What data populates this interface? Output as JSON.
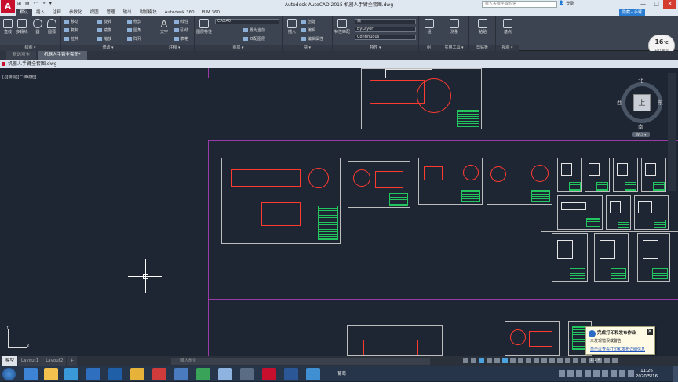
{
  "window": {
    "title": "Autodesk AutoCAD 2015    机器人手臂全套图.dwg",
    "search_placeholder": "键入关键字或短语",
    "signin": "登录",
    "controls": [
      "—",
      "□",
      "✕"
    ]
  },
  "app_button": "A",
  "quick_access": [
    "⊞",
    "▤",
    "↶",
    "↷",
    "▾"
  ],
  "ribbon_tabs": [
    "默认",
    "插入",
    "注释",
    "参数化",
    "视图",
    "管理",
    "输出",
    "附加模块",
    "Autodesk 360",
    "BIM 360"
  ],
  "active_tab": "默认",
  "cloud_button": "隐藏人手臂",
  "ribbon": {
    "draw": {
      "title": "绘图 ▾",
      "line": "直线",
      "polyline": "多段线",
      "circle": "圆",
      "arc": "圆弧"
    },
    "modify": {
      "title": "修改 ▾",
      "move": "移动",
      "rotate": "旋转",
      "trim": "修剪",
      "copy": "复制",
      "mirror": "镜像",
      "fillet": "圆角",
      "stretch": "拉伸",
      "scale": "缩放",
      "array": "阵列"
    },
    "annotation": {
      "title": "注释 ▾",
      "text": "文字",
      "dimension": "标注",
      "linear": "线性",
      "leader": "引线",
      "table": "表格"
    },
    "layers": {
      "title": "图层 ▾",
      "layer_props": "图层特性",
      "layer_name": "CAXA0",
      "state1": "置为当前",
      "state2": "匹配图层"
    },
    "block": {
      "title": "块 ▾",
      "insert": "插入",
      "create": "创建",
      "edit": "编辑",
      "attributes": "编辑属性"
    },
    "properties": {
      "title": "特性 ▾",
      "match": "特性匹配",
      "color": "白",
      "lineweight": "ByLayer",
      "linetype": "Continuous"
    },
    "groups": {
      "title": "组",
      "group": "组"
    },
    "utilities": {
      "title": "实用工具 ▾",
      "measure": "测量"
    },
    "clipboard": {
      "title": "剪贴板",
      "paste": "粘贴"
    },
    "view": {
      "title": "视图 ▾",
      "base": "基点"
    }
  },
  "temp_badge": {
    "value": "16",
    "unit": "°C",
    "sub": "+0.08k/s"
  },
  "doc_tabs": [
    "新选项卡",
    "机器人手臂全套图*"
  ],
  "active_doc_tab": "机器人手臂全套图*",
  "drawing": {
    "title": "机器人手臂全套图.dwg",
    "viewport_label": "[-][俯视][二维线框]"
  },
  "viewcube": {
    "top": "上",
    "north": "北",
    "south": "南",
    "west": "西",
    "east": "东",
    "wcs": "WCS ▾"
  },
  "ucs": {
    "x": "X",
    "y": "Y"
  },
  "layout_tabs": [
    "模型",
    "Layout1",
    "Layout2",
    "+"
  ],
  "active_layout": "模型",
  "command_placeholder": "键入命令",
  "status_scale": "1:1 ▾",
  "notification": {
    "title": "完成打印和发布作业",
    "subtitle": "未发现错误或警告",
    "link": "单击以查看打印和发布详细信息"
  },
  "taskbar": {
    "apps_label": "葡萄",
    "time": "11:26",
    "date": "2020/5/16"
  },
  "colors": {
    "canvas": "#1e2634",
    "ribbon": "#3c4452",
    "layout_border": "#9b3aa9",
    "titlebar": "#dfe7f1"
  }
}
